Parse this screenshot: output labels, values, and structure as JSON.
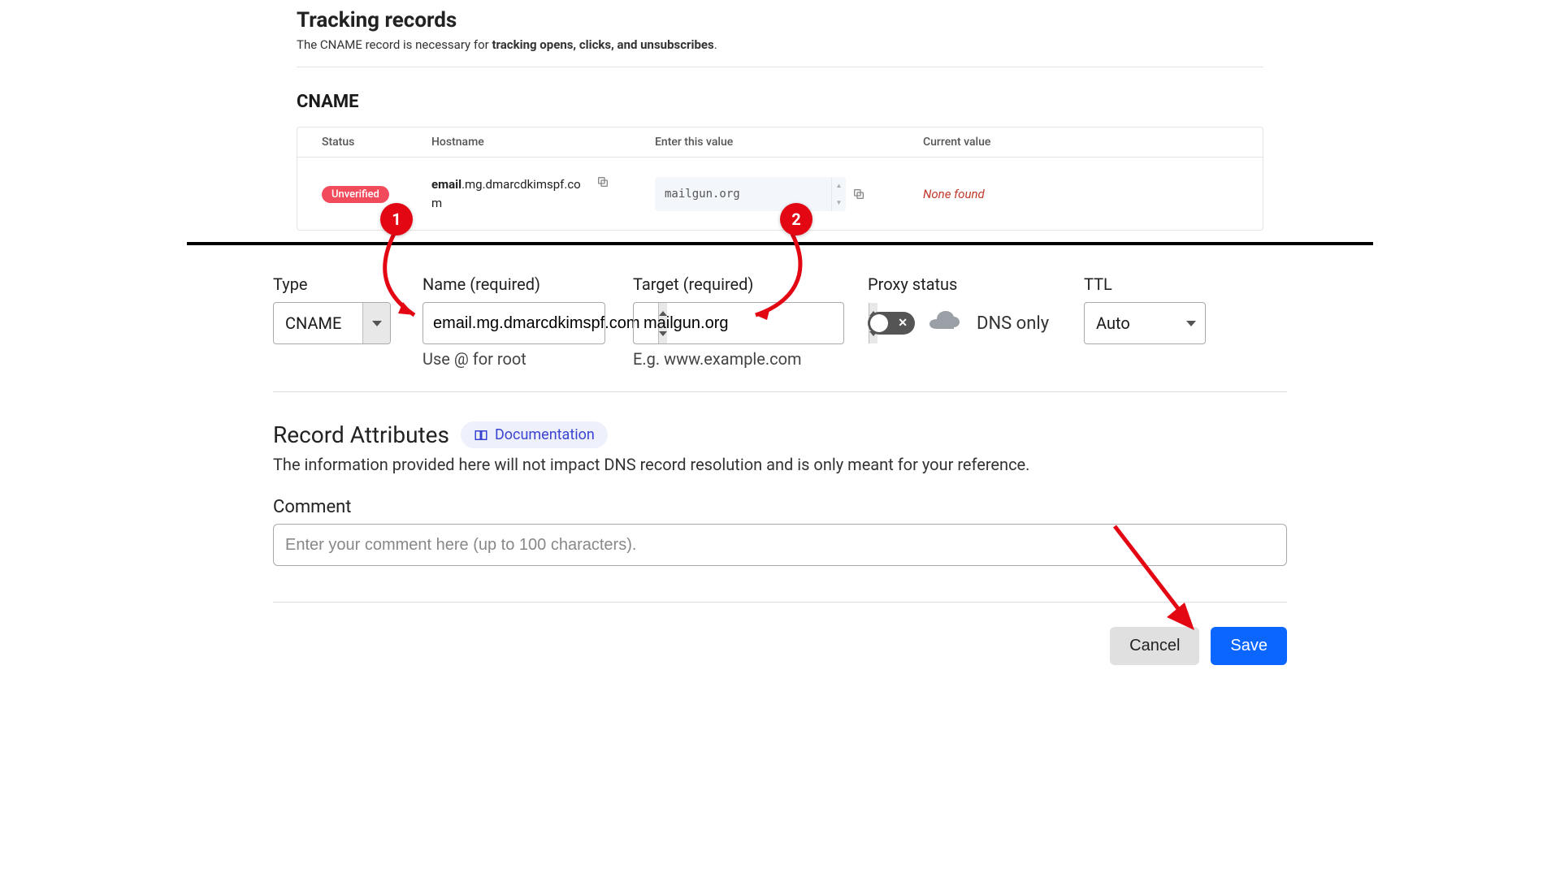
{
  "tracking": {
    "heading": "Tracking records",
    "sub_prefix": "The CNAME record is necessary for ",
    "sub_bold": "tracking opens, clicks, and unsubscribes",
    "sub_suffix": "."
  },
  "cname": {
    "heading": "CNAME",
    "headers": {
      "status": "Status",
      "hostname": "Hostname",
      "value": "Enter this value",
      "current": "Current value"
    },
    "row": {
      "status": "Unverified",
      "hostname_prefix": "email",
      "hostname_rest": ".mg.dmarcdkimspf.com",
      "value": "mailgun.org",
      "current": "None found"
    }
  },
  "form": {
    "type_label": "Type",
    "type_value": "CNAME",
    "name_label": "Name (required)",
    "name_value": "email.mg.dmarcdkimspf.com",
    "name_hint": "Use @ for root",
    "target_label": "Target (required)",
    "target_value": "mailgun.org",
    "target_hint": "E.g. www.example.com",
    "proxy_label": "Proxy status",
    "proxy_text": "DNS only",
    "ttl_label": "TTL",
    "ttl_value": "Auto"
  },
  "attributes": {
    "title": "Record Attributes",
    "doc_label": "Documentation",
    "desc": "The information provided here will not impact DNS record resolution and is only meant for your reference.",
    "comment_label": "Comment",
    "comment_placeholder": "Enter your comment here (up to 100 characters)."
  },
  "actions": {
    "cancel": "Cancel",
    "save": "Save"
  },
  "callouts": {
    "one": "1",
    "two": "2"
  }
}
